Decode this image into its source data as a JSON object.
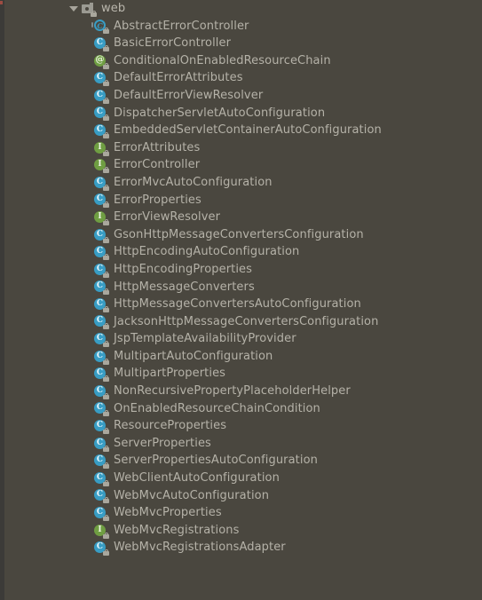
{
  "window": {
    "title": "Project",
    "background_color": "#4a473f",
    "text_color": "#b5b2a8",
    "gutter_color": "#3c3b38",
    "marker_color": "#9e4c42"
  },
  "icon_colors": {
    "class": "#389dc4",
    "interface": "#6f9e42",
    "annotation": "#6f9e42",
    "abstract_class": "#389dc4",
    "package": "#9b9a92",
    "lock_badge": "#a9a79d"
  },
  "tree": {
    "root": {
      "label": "web",
      "icon": "package-icon",
      "expanded": true,
      "twisty_icon": "triangle-down-icon"
    },
    "items": [
      {
        "label": "AbstractErrorController",
        "icon": "abstract-class-icon",
        "kind": "abstract_class"
      },
      {
        "label": "BasicErrorController",
        "icon": "class-icon",
        "kind": "class"
      },
      {
        "label": "ConditionalOnEnabledResourceChain",
        "icon": "annotation-icon",
        "kind": "annotation"
      },
      {
        "label": "DefaultErrorAttributes",
        "icon": "class-icon",
        "kind": "class"
      },
      {
        "label": "DefaultErrorViewResolver",
        "icon": "class-icon",
        "kind": "class"
      },
      {
        "label": "DispatcherServletAutoConfiguration",
        "icon": "class-icon",
        "kind": "class"
      },
      {
        "label": "EmbeddedServletContainerAutoConfiguration",
        "icon": "class-icon",
        "kind": "class"
      },
      {
        "label": "ErrorAttributes",
        "icon": "interface-icon",
        "kind": "interface"
      },
      {
        "label": "ErrorController",
        "icon": "interface-icon",
        "kind": "interface"
      },
      {
        "label": "ErrorMvcAutoConfiguration",
        "icon": "class-icon",
        "kind": "class"
      },
      {
        "label": "ErrorProperties",
        "icon": "class-icon",
        "kind": "class"
      },
      {
        "label": "ErrorViewResolver",
        "icon": "interface-icon",
        "kind": "interface"
      },
      {
        "label": "GsonHttpMessageConvertersConfiguration",
        "icon": "class-icon",
        "kind": "class"
      },
      {
        "label": "HttpEncodingAutoConfiguration",
        "icon": "class-icon",
        "kind": "class"
      },
      {
        "label": "HttpEncodingProperties",
        "icon": "class-icon",
        "kind": "class"
      },
      {
        "label": "HttpMessageConverters",
        "icon": "class-icon",
        "kind": "class"
      },
      {
        "label": "HttpMessageConvertersAutoConfiguration",
        "icon": "class-icon",
        "kind": "class"
      },
      {
        "label": "JacksonHttpMessageConvertersConfiguration",
        "icon": "class-icon",
        "kind": "class"
      },
      {
        "label": "JspTemplateAvailabilityProvider",
        "icon": "class-icon",
        "kind": "class"
      },
      {
        "label": "MultipartAutoConfiguration",
        "icon": "class-icon",
        "kind": "class"
      },
      {
        "label": "MultipartProperties",
        "icon": "class-icon",
        "kind": "class"
      },
      {
        "label": "NonRecursivePropertyPlaceholderHelper",
        "icon": "class-icon",
        "kind": "class"
      },
      {
        "label": "OnEnabledResourceChainCondition",
        "icon": "class-icon",
        "kind": "class"
      },
      {
        "label": "ResourceProperties",
        "icon": "class-icon",
        "kind": "class"
      },
      {
        "label": "ServerProperties",
        "icon": "class-icon",
        "kind": "class"
      },
      {
        "label": "ServerPropertiesAutoConfiguration",
        "icon": "class-icon",
        "kind": "class"
      },
      {
        "label": "WebClientAutoConfiguration",
        "icon": "class-icon",
        "kind": "class"
      },
      {
        "label": "WebMvcAutoConfiguration",
        "icon": "class-icon",
        "kind": "class"
      },
      {
        "label": "WebMvcProperties",
        "icon": "class-icon",
        "kind": "class"
      },
      {
        "label": "WebMvcRegistrations",
        "icon": "interface-icon",
        "kind": "interface"
      },
      {
        "label": "WebMvcRegistrationsAdapter",
        "icon": "class-icon",
        "kind": "class"
      }
    ]
  }
}
